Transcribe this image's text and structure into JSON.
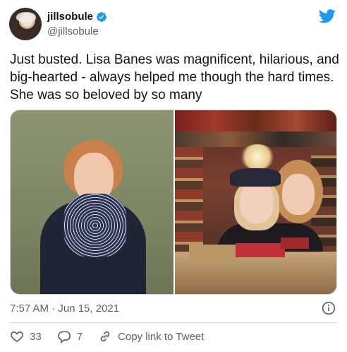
{
  "author": {
    "display_name": "jillsobule",
    "handle": "@jillsobule",
    "verified": true
  },
  "tweet": {
    "text": "Just busted. Lisa Banes was magnificent, hilarious, and big-hearted - always helped me though the hard times. She was so beloved by so many"
  },
  "meta": {
    "timestamp": "7:57 AM · Jun 15, 2021"
  },
  "actions": {
    "like_count": "33",
    "reply_count": "7",
    "copy_link_label": "Copy link to Tweet"
  },
  "colors": {
    "brand": "#1d9bf0",
    "text": "#0f1419",
    "secondary": "#536471",
    "border": "#cfd9de"
  },
  "icons": [
    "avatar",
    "verified-badge-icon",
    "twitter-bird-icon",
    "info-icon",
    "heart-icon",
    "reply-icon",
    "link-icon"
  ]
}
